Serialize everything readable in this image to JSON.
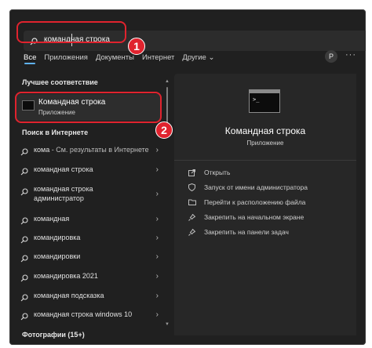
{
  "search": {
    "query": "команд​ная строка",
    "typed": "кома",
    "rest": "ндная строка"
  },
  "tabs": [
    {
      "label": "Все"
    },
    {
      "label": "Приложения"
    },
    {
      "label": "Документы"
    },
    {
      "label": "Интернет"
    },
    {
      "label": "Другие ⌄"
    }
  ],
  "account": {
    "initial": "P"
  },
  "more_label": "···",
  "best_match": {
    "heading": "Лучшее соответствие",
    "title": "Командная строка",
    "subtitle": "Приложение"
  },
  "web": {
    "heading": "Поиск в Интернете",
    "items": [
      {
        "bold": "кома",
        "muted": " - См. результаты в Интернете"
      },
      {
        "bold": "командная строка",
        "muted": ""
      },
      {
        "bold": "командная строка",
        "muted": ""
      },
      {
        "bold": "администратор",
        "muted": ""
      },
      {
        "bold": "командная",
        "muted": ""
      },
      {
        "bold": "командировка",
        "muted": ""
      },
      {
        "bold": "командировки",
        "muted": ""
      },
      {
        "bold": "командировка 2021",
        "muted": ""
      },
      {
        "bold": "командная подсказка",
        "muted": ""
      },
      {
        "bold": "командная строка windows 10",
        "muted": ""
      }
    ]
  },
  "photos": {
    "heading": "Фотографии (15+)"
  },
  "preview": {
    "title": "Командная строка",
    "subtitle": "Приложение",
    "icon_prompt": ">_"
  },
  "actions": [
    {
      "label": "Открыть",
      "icon": "open-icon"
    },
    {
      "label": "Запуск от имени администратора",
      "icon": "shield-icon"
    },
    {
      "label": "Перейти к расположению файла",
      "icon": "folder-icon"
    },
    {
      "label": "Закрепить на начальном экране",
      "icon": "pin-icon"
    },
    {
      "label": "Закрепить на панели задач",
      "icon": "pin-icon"
    }
  ],
  "badges": [
    "1",
    "2"
  ],
  "colors": {
    "highlight": "#e0232e",
    "accent": "#5fb2f2",
    "background": "#202020"
  }
}
